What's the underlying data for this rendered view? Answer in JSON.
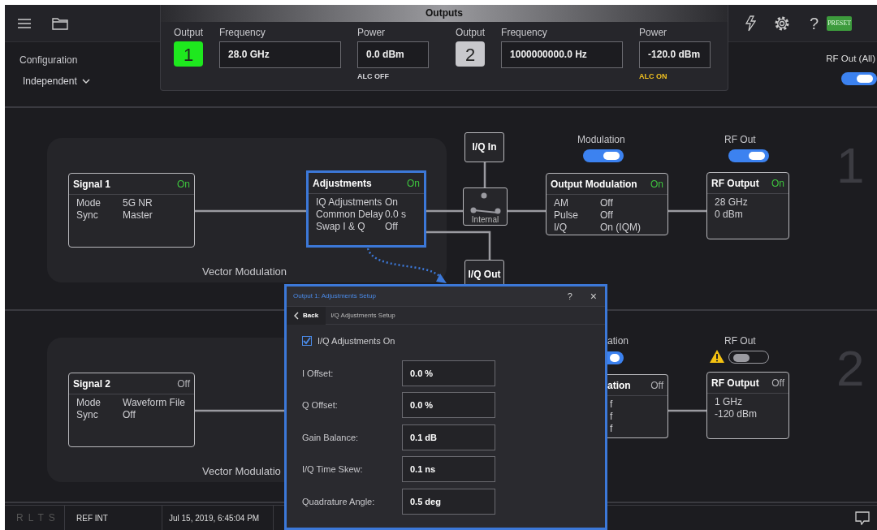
{
  "toolbar": {
    "help": "?",
    "preset": "PRESET"
  },
  "configuration": {
    "label": "Configuration",
    "value": "Independent"
  },
  "outputs_panel": {
    "title": "Outputs",
    "outputs": [
      {
        "label": "Output",
        "number": "1",
        "selected": true,
        "frequency_label": "Frequency",
        "frequency": "28.0 GHz",
        "power_label": "Power",
        "power": "0.0 dBm",
        "alc": "ALC OFF",
        "alc_on": false
      },
      {
        "label": "Output",
        "number": "2",
        "selected": false,
        "frequency_label": "Frequency",
        "frequency": "1000000000.0 Hz",
        "power_label": "Power",
        "power": "-120.0 dBm",
        "alc": "ALC ON",
        "alc_on": true
      }
    ]
  },
  "rf_out_all": {
    "label": "RF Out (All)",
    "on": true
  },
  "channels": [
    {
      "number": "1",
      "group_label": "Vector Modulation",
      "signal": {
        "title": "Signal 1",
        "status": "On",
        "on": true,
        "rows": [
          {
            "name": "Mode",
            "value": "5G NR"
          },
          {
            "name": "Sync",
            "value": "Master"
          }
        ]
      },
      "adjustments": {
        "title": "Adjustments",
        "status": "On",
        "on": true,
        "selected": true,
        "rows": [
          {
            "name": "IQ Adjustments",
            "value": "On"
          },
          {
            "name": "Common Delay",
            "value": "0.0 s"
          },
          {
            "name": "Swap I & Q",
            "value": "Off"
          }
        ]
      },
      "iq_in": "I/Q In",
      "switch_label": "Internal",
      "iq_out": "I/Q Out",
      "modulation": {
        "label": "Modulation",
        "on": true
      },
      "output_modulation": {
        "covered": false,
        "title": "Output Modulation",
        "status": "On",
        "on": true,
        "rows": [
          {
            "name": "AM",
            "value": "Off"
          },
          {
            "name": "Pulse",
            "value": "Off"
          },
          {
            "name": "I/Q",
            "value": "On (IQM)"
          }
        ]
      },
      "rf_out": {
        "label": "RF Out",
        "on": true,
        "warning": false
      },
      "rf_output": {
        "title": "RF Output",
        "status": "On",
        "on": true,
        "lines": [
          "28 GHz",
          "0 dBm"
        ]
      }
    },
    {
      "number": "2",
      "group_label": "Vector Modulatio",
      "signal": {
        "title": "Signal 2",
        "status": "Off",
        "on": false,
        "rows": [
          {
            "name": "Mode",
            "value": "Waveform File"
          },
          {
            "name": "Sync",
            "value": "Off"
          }
        ]
      },
      "modulation": {
        "label": "ation",
        "on": true
      },
      "output_modulation": {
        "covered": true,
        "title": "ation",
        "status": "Off",
        "on": false,
        "rows": [
          {
            "value": "f"
          },
          {
            "value": "f"
          },
          {
            "value": "f"
          }
        ]
      },
      "rf_out": {
        "label": "RF Out",
        "on": false,
        "warning": true
      },
      "rf_output": {
        "title": "RF Output",
        "status": "Off",
        "on": false,
        "lines": [
          "1 GHz",
          "-120 dBm"
        ]
      }
    }
  ],
  "dialog": {
    "title": "Output 1: Adjustments Setup",
    "help": "?",
    "close": "×",
    "back": "Back",
    "breadcrumb": "I/Q Adjustments Setup",
    "checkbox": {
      "label": "I/Q Adjustments On",
      "checked": true
    },
    "fields": [
      {
        "label": "I Offset:",
        "value": "0.0 %"
      },
      {
        "label": "Q Offset:",
        "value": "0.0 %"
      },
      {
        "label": "Gain Balance:",
        "value": "0.1 dB"
      },
      {
        "label": "I/Q Time Skew:",
        "value": "0.1 ns"
      },
      {
        "label": "Quadrature Angle:",
        "value": "0.5 deg"
      }
    ]
  },
  "status_bar": {
    "indicators": "RLTS",
    "reference": "REF INT",
    "datetime": "Jul 15, 2019, 6:45:04 PM"
  }
}
